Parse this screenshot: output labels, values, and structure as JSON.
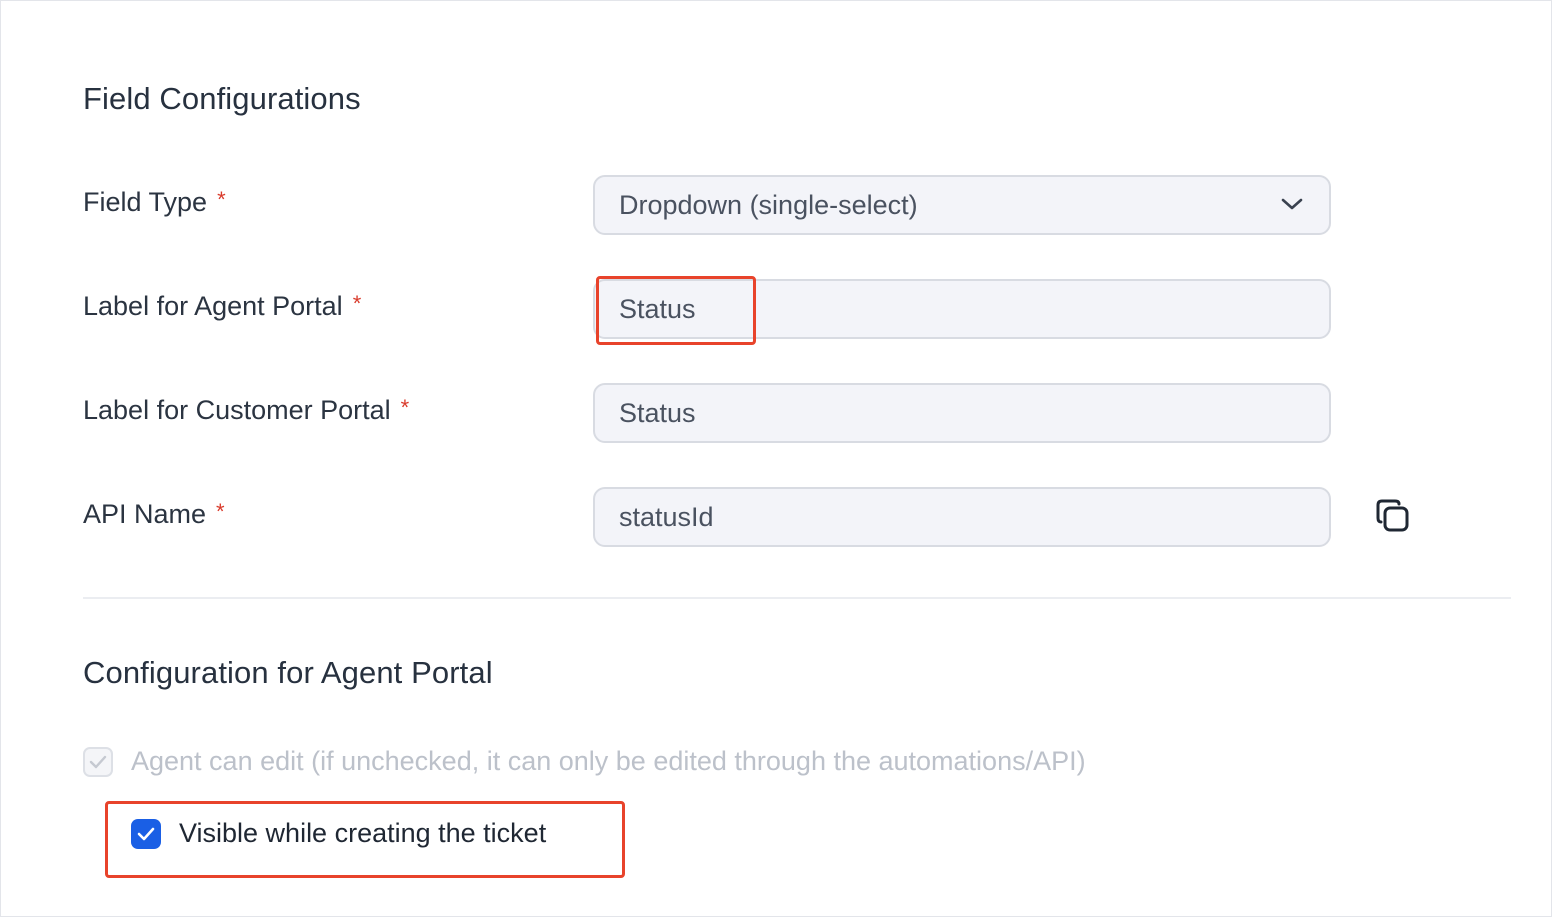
{
  "field_configurations": {
    "title": "Field Configurations",
    "fields": [
      {
        "label": "Field Type",
        "required_mark": "*",
        "value": "Dropdown (single-select)"
      },
      {
        "label": "Label for Agent Portal",
        "required_mark": "*",
        "value": "Status"
      },
      {
        "label": "Label for Customer Portal",
        "required_mark": "*",
        "value": "Status"
      },
      {
        "label": "API Name",
        "required_mark": "*",
        "value": "statusId"
      }
    ]
  },
  "agent_portal_config": {
    "title": "Configuration for Agent Portal",
    "options": [
      {
        "label": "Agent can edit (if unchecked, it can only be edited through the automations/API)",
        "checked": true,
        "disabled": true
      },
      {
        "label": "Visible while creating the ticket",
        "checked": true,
        "disabled": false
      }
    ]
  },
  "colors": {
    "accent": "#1a5fe5",
    "highlight": "#e8432b",
    "required": "#d93a2b"
  },
  "icons": {
    "dropdown": "chevron-down-icon",
    "copy": "copy-icon",
    "check": "check-icon"
  }
}
